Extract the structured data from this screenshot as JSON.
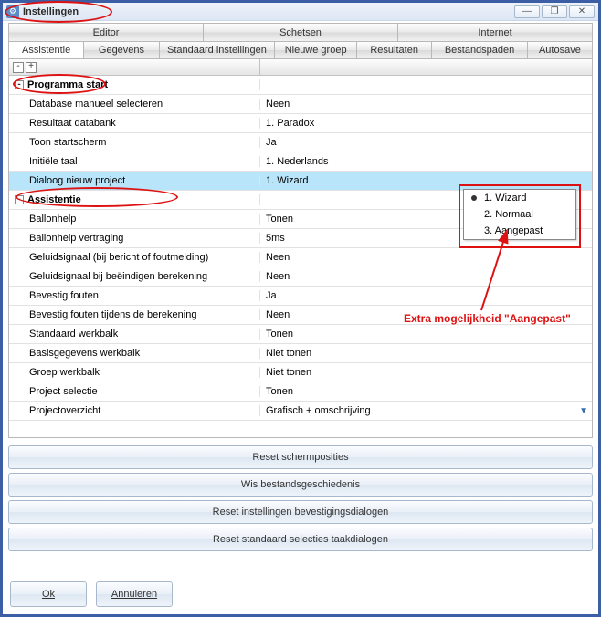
{
  "window": {
    "title": "Instellingen",
    "icon": "settings-icon"
  },
  "win_buttons": {
    "min": "—",
    "max": "❐",
    "close": "✕"
  },
  "tabs_top": [
    "Editor",
    "Schetsen",
    "Internet"
  ],
  "tabs_bottom": [
    "Assistentie",
    "Gegevens",
    "Standaard instellingen",
    "Nieuwe groep",
    "Resultaten",
    "Bestandspaden",
    "Autosave"
  ],
  "active_tab": "Assistentie",
  "header_tools": {
    "collapse": "-",
    "expand": "+"
  },
  "groups": [
    {
      "name": "Programma start",
      "rows": [
        {
          "label": "Database manueel selecteren",
          "value": "Neen"
        },
        {
          "label": "Resultaat databank",
          "value": "1. Paradox"
        },
        {
          "label": "Toon startscherm",
          "value": "Ja"
        },
        {
          "label": "Initiële taal",
          "value": "1. Nederlands"
        },
        {
          "label": "Dialoog nieuw project",
          "value": "1. Wizard",
          "selected": true,
          "highlighted_label": true
        }
      ]
    },
    {
      "name": "Assistentie",
      "rows": [
        {
          "label": "Ballonhelp",
          "value": "Tonen"
        },
        {
          "label": "Ballonhelp vertraging",
          "value": "5ms"
        },
        {
          "label": "Geluidsignaal (bij bericht of foutmelding)",
          "value": "Neen"
        },
        {
          "label": "Geluidsignaal bij beëindigen berekening",
          "value": "Neen"
        },
        {
          "label": "Bevestig fouten",
          "value": "Ja"
        },
        {
          "label": "Bevestig fouten tijdens de berekening",
          "value": "Neen"
        },
        {
          "label": "Standaard werkbalk",
          "value": "Tonen"
        },
        {
          "label": "Basisgegevens werkbalk",
          "value": "Niet tonen"
        },
        {
          "label": "Groep werkbalk",
          "value": "Niet tonen"
        },
        {
          "label": "Project selectie",
          "value": "Tonen"
        },
        {
          "label": "Projectoverzicht",
          "value": "Grafisch + omschrijving",
          "chevron": true
        }
      ]
    }
  ],
  "dropdown": {
    "items": [
      "1. Wizard",
      "2. Normaal",
      "3. Aangepast"
    ],
    "selected_index": 0
  },
  "annotation_text": "Extra mogelijkheid \"Aangepast\"",
  "wide_buttons": [
    "Reset schermposities",
    "Wis bestandsgeschiedenis",
    "Reset instellingen bevestigingsdialogen",
    "Reset standaard selecties taakdialogen"
  ],
  "footer": {
    "ok": "Ok",
    "cancel": "Annuleren"
  }
}
